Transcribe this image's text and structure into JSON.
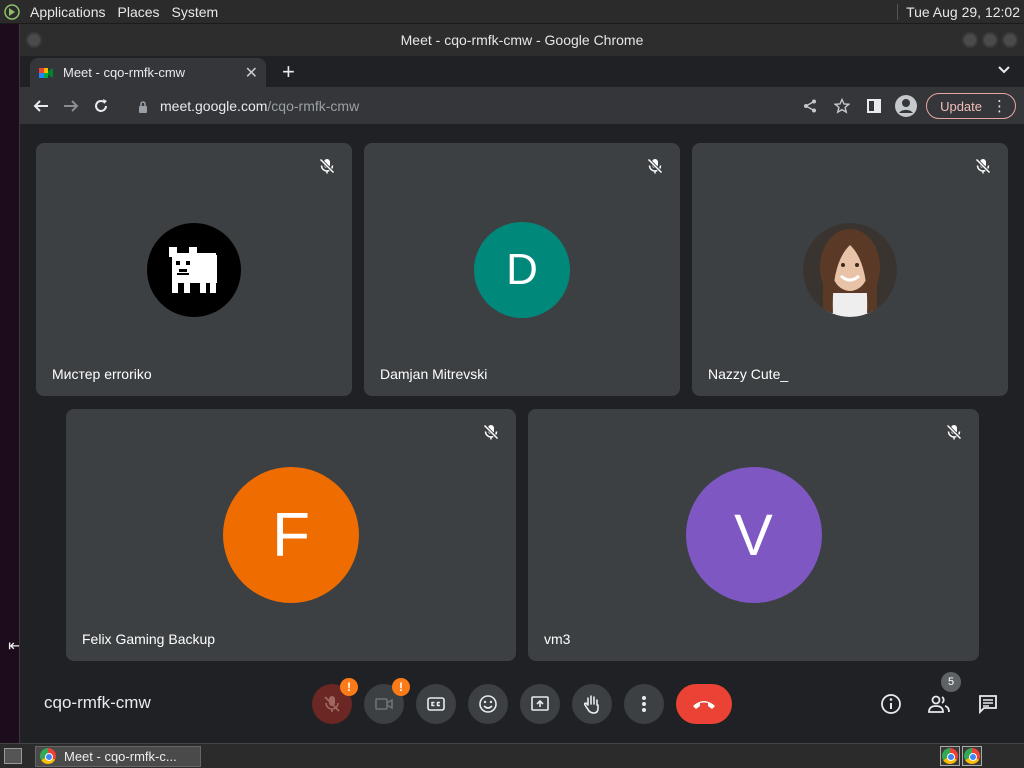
{
  "top_panel": {
    "menus": [
      "Applications",
      "Places",
      "System"
    ],
    "clock": "Tue Aug 29, 12:02"
  },
  "window": {
    "title": "Meet - cqo-rmfk-cmw - Google Chrome"
  },
  "tab": {
    "title": "Meet - cqo-rmfk-cmw",
    "close": "✕",
    "new_tab": "+"
  },
  "toolbar": {
    "url_host": "meet.google.com",
    "url_path": "/cqo-rmfk-cmw",
    "update_label": "Update"
  },
  "participants": [
    {
      "name": "Мистер erroriko",
      "avatar_type": "image",
      "avatar_color": "#000000",
      "muted": true
    },
    {
      "name": "Damjan Mitrevski",
      "avatar_type": "letter",
      "letter": "D",
      "avatar_color": "#00897b",
      "muted": true
    },
    {
      "name": "Nazzy Cute_",
      "avatar_type": "photo",
      "avatar_color": "#8a6a58",
      "muted": true
    },
    {
      "name": "Felix Gaming Backup",
      "avatar_type": "letter",
      "letter": "F",
      "avatar_color": "#ef6c00",
      "muted": true
    },
    {
      "name": "vm3",
      "avatar_type": "letter",
      "letter": "V",
      "avatar_color": "#7e57c2",
      "muted": true
    }
  ],
  "bottom_bar": {
    "meeting_code": "cqo-rmfk-cmw",
    "warning_mark": "!",
    "people_count": "5"
  },
  "taskbar": {
    "task_label": "Meet - cqo-rmfk-c..."
  },
  "colors": {
    "meet_bg": "#202124",
    "tile_bg": "#3c4043",
    "end_call_red": "#ea4335",
    "warning_orange": "#fa7b17"
  }
}
